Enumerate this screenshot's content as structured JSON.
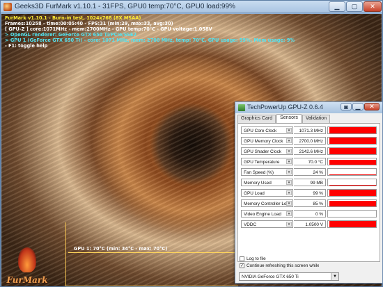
{
  "furmark": {
    "window_title": "Geeks3D FurMark v1.10.1 - 31FPS, GPU0 temp:70°C, GPU0 load:99%",
    "osd": [
      {
        "text": "FurMark v1.10.1 - Burn-in test, 1024x768 (8X MSAA)",
        "color": "yellow"
      },
      {
        "text": "Frames:10258 - time:00:05:40 - FPS:31 (min:29, max:33, avg:30)",
        "color": "white"
      },
      {
        "text": "[ GPU-Z ] core:1071MHz - mem:2700MHz - GPU temp:70°C - GPU voltage:1.058V",
        "color": "white"
      },
      {
        "text": "> OpenGL renderer: GeForce GTX 650 Ti/PCIe/SSE2",
        "color": "cyan"
      },
      {
        "text": "> GPU 1 (GeForce GTX 650 Ti) - core: 1071 MHz, mem: 2700 MHz, temp: 70°C, GPU usage: 99%, Mem usage: 9%",
        "color": "cyan"
      },
      {
        "text": "- F1: toggle help",
        "color": "white"
      }
    ],
    "graph_label": "GPU 1: 70°C (min: 34°C - max: 70°C)",
    "logo_text": "FurMark"
  },
  "gpuz": {
    "window_title": "TechPowerUp GPU-Z 0.6.4",
    "tabs": [
      "Graphics Card",
      "Sensors",
      "Validation"
    ],
    "active_tab": "Sensors",
    "sensors": [
      {
        "label": "GPU Core Clock",
        "value": "1071.3 MHz",
        "level": 0.97
      },
      {
        "label": "GPU Memory Clock",
        "value": "2700.0 MHz",
        "level": 0.97
      },
      {
        "label": "GPU Shader Clock",
        "value": "2142.6 MHz",
        "level": 0.97
      },
      {
        "label": "GPU Temperature",
        "value": "70.0 °C",
        "level": 0.8
      },
      {
        "label": "Fan Speed (%)",
        "value": "24 %",
        "level": 0.12
      },
      {
        "label": "Memory Used",
        "value": "99 MB",
        "level": 0.04
      },
      {
        "label": "GPU Load",
        "value": "99 %",
        "level": 0.97
      },
      {
        "label": "Memory Controller Load",
        "value": "85 %",
        "level": 0.85
      },
      {
        "label": "Video Engine Load",
        "value": "0 %",
        "level": 0.0
      },
      {
        "label": "VDDC",
        "value": "1.0500 V",
        "level": 0.97
      }
    ],
    "log_to_file": {
      "label": "Log to file",
      "checked": false
    },
    "continue_refresh": {
      "label": "Continue refreshing this screen while GPU-Z is in the background",
      "checked": true
    },
    "gpu_selected": "NVIDIA GeForce GTX 650 Ti"
  },
  "colors": {
    "graph_fill": "#ff0000",
    "osd_yellow": "#ffee33",
    "osd_cyan": "#52e3f0"
  }
}
